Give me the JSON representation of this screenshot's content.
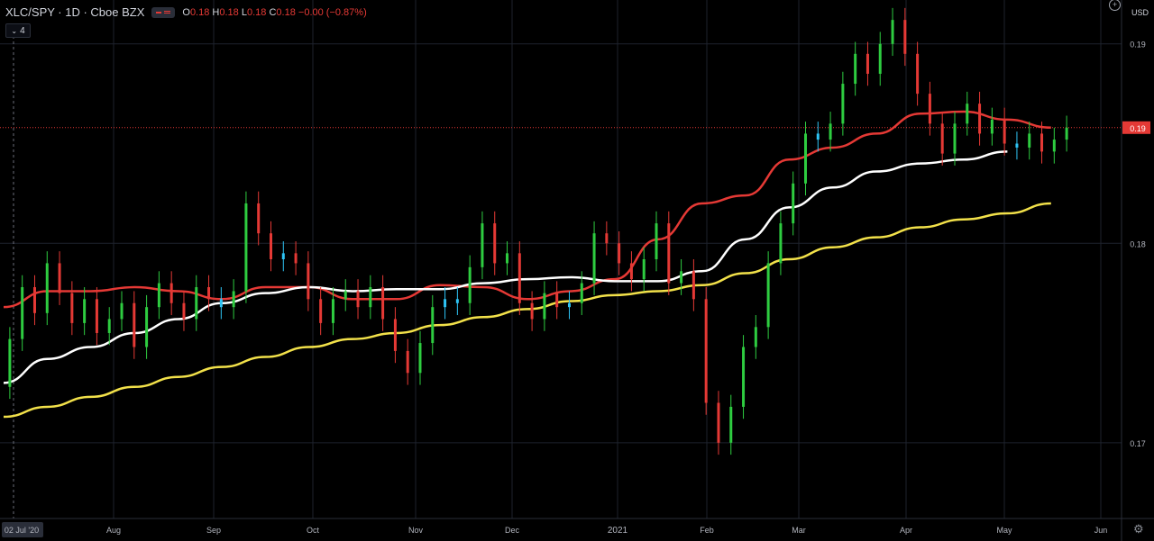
{
  "header": {
    "symbol": "XLC/SPY · 1D · Cboe BZX",
    "ohlc_open_label": "O",
    "ohlc_open": "0.18",
    "ohlc_high_label": "H",
    "ohlc_high": "0.18",
    "ohlc_low_label": "L",
    "ohlc_low": "0.18",
    "ohlc_close_label": "C",
    "ohlc_close": "0.18",
    "change": "−0.00 (−0.87%)",
    "indicator_count": "4",
    "currency": "USD",
    "settings_icon": "gear-icon",
    "add_icon": "plus-circle-icon"
  },
  "colors": {
    "background": "#000000",
    "up": "#2ecc40",
    "down": "#e53935",
    "neutral_candle": "#2ec4f5",
    "ma_fast": "#e53935",
    "ma_mid": "#ffffff",
    "ma_slow": "#f2e14a",
    "price_tag": "#e53935"
  },
  "chart_data": {
    "type": "line",
    "title": "XLC/SPY · 1D · Cboe BZX",
    "y_ticks": [
      "0.19",
      "0.18",
      "0.17"
    ],
    "last_price_label": "0.19",
    "x_tick_labels": [
      "02 Jul '20",
      "Aug",
      "Sep",
      "Oct",
      "Nov",
      "Dec",
      "2021",
      "Feb",
      "Mar",
      "Apr",
      "May",
      "Jun"
    ],
    "ylim": [
      0.1662,
      0.1922
    ],
    "grid": true,
    "candles_approx": [
      [
        0.1728,
        0.1752
      ],
      [
        0.1752,
        0.1778
      ],
      [
        0.1778,
        0.1765
      ],
      [
        0.1765,
        0.179
      ],
      [
        0.179,
        0.1775
      ],
      [
        0.1775,
        0.176
      ],
      [
        0.176,
        0.1772
      ],
      [
        0.1772,
        0.1755
      ],
      [
        0.1755,
        0.1762
      ],
      [
        0.1762,
        0.177
      ],
      [
        0.177,
        0.1748
      ],
      [
        0.1748,
        0.1768
      ],
      [
        0.1768,
        0.178
      ],
      [
        0.178,
        0.177
      ],
      [
        0.177,
        0.1762
      ],
      [
        0.1762,
        0.1778
      ],
      [
        0.1778,
        0.1772
      ],
      [
        0.1772,
        0.1768
      ],
      [
        0.1768,
        0.1776
      ],
      [
        0.1776,
        0.182
      ],
      [
        0.182,
        0.1805
      ],
      [
        0.1805,
        0.1792
      ],
      [
        0.1792,
        0.1795
      ],
      [
        0.1795,
        0.179
      ],
      [
        0.179,
        0.1772
      ],
      [
        0.1772,
        0.176
      ],
      [
        0.176,
        0.1772
      ],
      [
        0.1772,
        0.1776
      ],
      [
        0.1776,
        0.1768
      ],
      [
        0.1768,
        0.1778
      ],
      [
        0.1778,
        0.1762
      ],
      [
        0.1762,
        0.1746
      ],
      [
        0.1746,
        0.1735
      ],
      [
        0.1735,
        0.175
      ],
      [
        0.175,
        0.1768
      ],
      [
        0.1768,
        0.1772
      ],
      [
        0.1772,
        0.177
      ],
      [
        0.177,
        0.1788
      ],
      [
        0.1788,
        0.181
      ],
      [
        0.181,
        0.179
      ],
      [
        0.179,
        0.1795
      ],
      [
        0.1795,
        0.177
      ],
      [
        0.177,
        0.1762
      ],
      [
        0.1762,
        0.1775
      ],
      [
        0.1775,
        0.1768
      ],
      [
        0.1768,
        0.177
      ],
      [
        0.177,
        0.178
      ],
      [
        0.178,
        0.1805
      ],
      [
        0.1805,
        0.18
      ],
      [
        0.18,
        0.179
      ],
      [
        0.179,
        0.1782
      ],
      [
        0.1782,
        0.1792
      ],
      [
        0.1792,
        0.181
      ],
      [
        0.181,
        0.178
      ],
      [
        0.178,
        0.1786
      ],
      [
        0.1786,
        0.1772
      ],
      [
        0.1772,
        0.172
      ],
      [
        0.172,
        0.17
      ],
      [
        0.17,
        0.1718
      ],
      [
        0.1718,
        0.1748
      ],
      [
        0.1748,
        0.1758
      ],
      [
        0.1758,
        0.179
      ],
      [
        0.179,
        0.181
      ],
      [
        0.181,
        0.183
      ],
      [
        0.183,
        0.1855
      ],
      [
        0.1855,
        0.1852
      ],
      [
        0.1852,
        0.186
      ],
      [
        0.186,
        0.188
      ],
      [
        0.188,
        0.1895
      ],
      [
        0.1895,
        0.1885
      ],
      [
        0.1885,
        0.19
      ],
      [
        0.19,
        0.1912
      ],
      [
        0.1912,
        0.1895
      ],
      [
        0.1895,
        0.1875
      ],
      [
        0.1875,
        0.186
      ],
      [
        0.186,
        0.1845
      ],
      [
        0.1845,
        0.186
      ],
      [
        0.186,
        0.187
      ],
      [
        0.187,
        0.1855
      ],
      [
        0.1855,
        0.1862
      ],
      [
        0.1862,
        0.185
      ],
      [
        0.185,
        0.1848
      ],
      [
        0.1848,
        0.1855
      ],
      [
        0.1855,
        0.1846
      ],
      [
        0.1846,
        0.1852
      ],
      [
        0.1852,
        0.1858
      ]
    ],
    "series": [
      {
        "values_approx": [
          0.1768,
          0.1776,
          0.1776,
          0.1778,
          0.1776,
          0.1772,
          0.1778,
          0.1778,
          0.1772,
          0.1772,
          0.1779,
          0.1778,
          0.1772,
          0.1776,
          0.1782,
          0.1802,
          0.182,
          0.1824,
          0.1842,
          0.1848,
          0.1855,
          0.1865,
          0.1866,
          0.1862,
          0.1858
        ],
        "x_index": [
          0,
          10,
          20,
          30,
          40,
          50,
          60,
          70,
          80,
          90,
          100,
          110,
          120,
          130,
          140,
          150,
          160,
          170,
          180,
          190,
          200,
          210,
          220,
          230,
          240
        ]
      },
      {
        "values_approx": [
          0.173,
          0.1742,
          0.1748,
          0.1755,
          0.1762,
          0.177,
          0.1775,
          0.1778,
          0.1776,
          0.1777,
          0.1777,
          0.178,
          0.1782,
          0.1783,
          0.1781,
          0.1781,
          0.1786,
          0.1802,
          0.1818,
          0.1828,
          0.1836,
          0.184,
          0.1842,
          0.1846
        ],
        "x_index": [
          0,
          10,
          20,
          30,
          40,
          50,
          60,
          70,
          80,
          90,
          100,
          110,
          120,
          130,
          140,
          150,
          160,
          170,
          180,
          190,
          200,
          210,
          220,
          230
        ]
      },
      {
        "values_approx": [
          0.1713,
          0.1718,
          0.1723,
          0.1728,
          0.1733,
          0.1738,
          0.1743,
          0.1748,
          0.1752,
          0.1755,
          0.1759,
          0.1763,
          0.1767,
          0.1771,
          0.1774,
          0.1776,
          0.1779,
          0.1785,
          0.1792,
          0.1798,
          0.1803,
          0.1808,
          0.1812,
          0.1815,
          0.182
        ],
        "x_index": [
          0,
          10,
          20,
          30,
          40,
          50,
          60,
          70,
          80,
          90,
          100,
          110,
          120,
          130,
          140,
          150,
          160,
          170,
          180,
          190,
          200,
          210,
          220,
          230,
          240
        ]
      }
    ]
  }
}
